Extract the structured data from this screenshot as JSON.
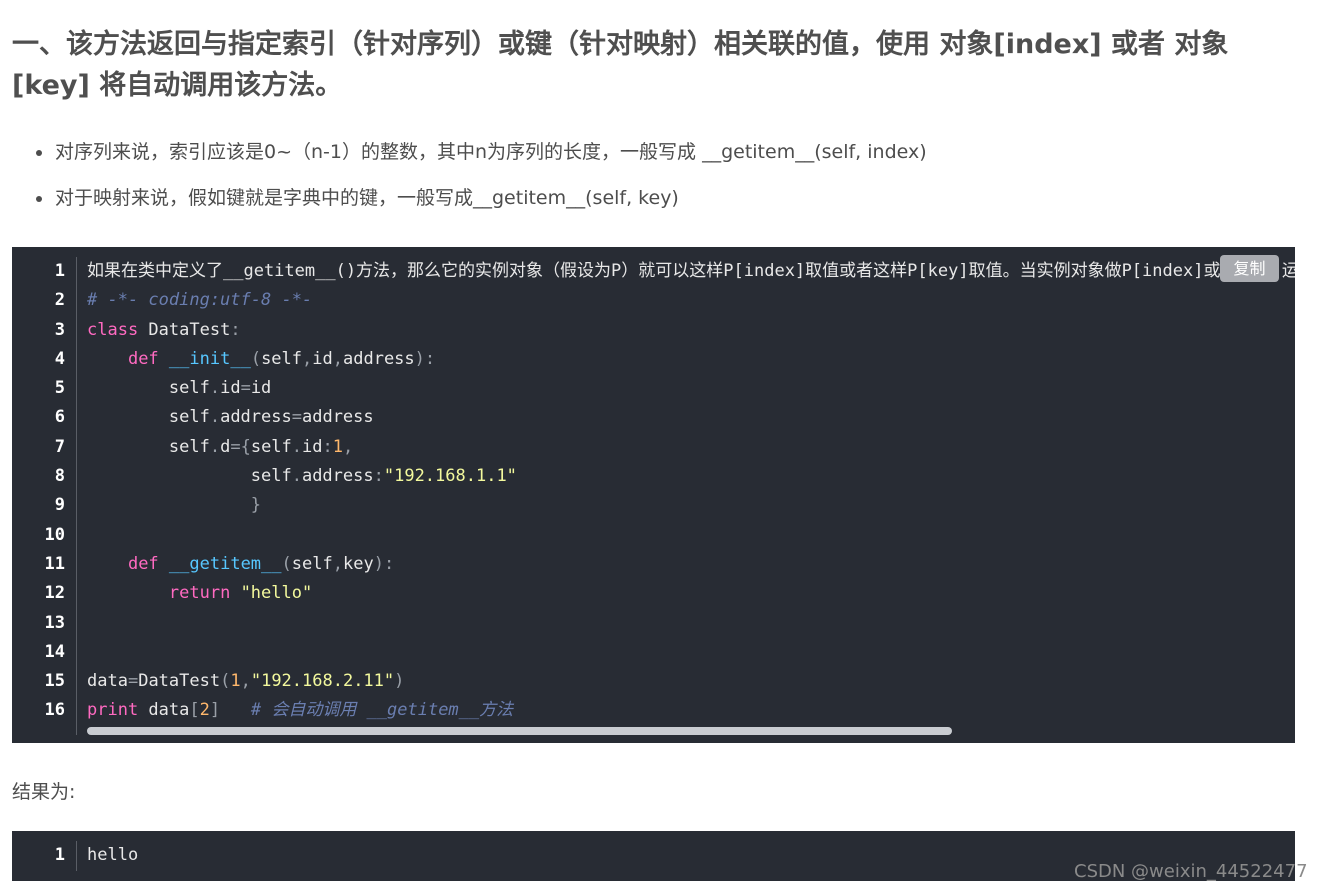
{
  "heading": "一、该方法返回与指定索引（针对序列）或键（针对映射）相关联的值，使用 对象[index] 或者 对象[key] 将自动调用该方法。",
  "bullets": [
    "对序列来说，索引应该是0~（n-1）的整数，其中n为序列的长度，一般写成 __getitem__(self, index)",
    "对于映射来说，假如键就是字典中的键，一般写成__getitem__(self, key)"
  ],
  "code1": {
    "copy_label": "复制",
    "line_numbers": [
      "1",
      "2",
      "3",
      "4",
      "5",
      "6",
      "7",
      "8",
      "9",
      "10",
      "11",
      "12",
      "13",
      "14",
      "15",
      "16"
    ],
    "lines": [
      "如果在类中定义了__getitem__()方法，那么它的实例对象（假设为P）就可以这样P[index]取值或者这样P[key]取值。当实例对象做P[index]或P[key]运算时，就会调用类中的__getitem__()方法",
      "# -*- coding:utf-8 -*-",
      "class DataTest:",
      "    def __init__(self,id,address):",
      "        self.id=id",
      "        self.address=address",
      "        self.d={self.id:1,",
      "                self.address:\"192.168.1.1\"",
      "                }",
      "",
      "    def __getitem__(self,key):",
      "        return \"hello\"",
      "",
      "",
      "data=DataTest(1,\"192.168.2.11\")",
      "print data[2]   # 会自动调用 __getitem__方法"
    ]
  },
  "result_label": "结果为:",
  "code2": {
    "line_numbers": [
      "1"
    ],
    "lines": [
      "hello"
    ]
  },
  "watermark": "CSDN @weixin_44522477",
  "colors": {
    "code_bg": "#282c34",
    "keyword": "#ff6ac1",
    "function": "#57c7ff",
    "string": "#f3f99d",
    "comment": "#6a7eb0"
  }
}
